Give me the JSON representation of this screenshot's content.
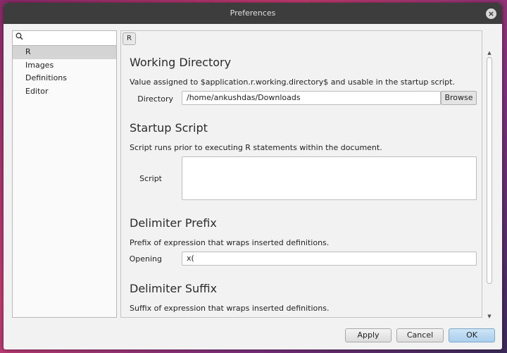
{
  "window": {
    "title": "Preferences",
    "close_glyph": "×"
  },
  "sidebar": {
    "search": {
      "icon": "search-icon",
      "value": "",
      "placeholder": ""
    },
    "items": [
      {
        "label": "R",
        "selected": true
      },
      {
        "label": "Images",
        "selected": false
      },
      {
        "label": "Definitions",
        "selected": false
      },
      {
        "label": "Editor",
        "selected": false
      }
    ]
  },
  "main": {
    "breadcrumb": "R",
    "sections": {
      "working_directory": {
        "heading": "Working Directory",
        "description": "Value assigned to $application.r.working.directory$ and usable in the startup script.",
        "field_label": "Directory",
        "value": "/home/ankushdas/Downloads",
        "browse_label": "Browse"
      },
      "startup_script": {
        "heading": "Startup Script",
        "description": "Script runs prior to executing R statements within the document.",
        "field_label": "Script",
        "value": ""
      },
      "delimiter_prefix": {
        "heading": "Delimiter Prefix",
        "description": "Prefix of expression that wraps inserted definitions.",
        "field_label": "Opening",
        "value": "x("
      },
      "delimiter_suffix": {
        "heading": "Delimiter Suffix",
        "description": "Suffix of expression that wraps inserted definitions."
      }
    }
  },
  "footer": {
    "apply_label": "Apply",
    "cancel_label": "Cancel",
    "ok_label": "OK"
  },
  "colors": {
    "ok_button": "#a9cfee",
    "selected_item": "#d4d4d4",
    "titlebar": "#3d3d3d"
  }
}
